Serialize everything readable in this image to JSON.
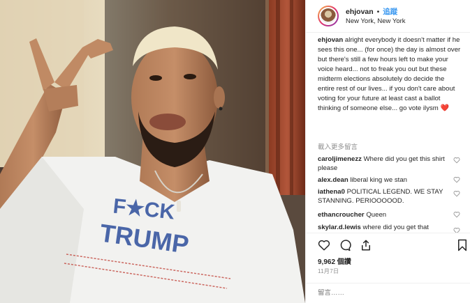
{
  "post": {
    "username": "ehjovan",
    "separator": "•",
    "follow_label": "追蹤",
    "location": "New York, New York",
    "caption_user": "ehjovan",
    "caption_text": " alright everybody it doesn't matter if he sees this one... (for once) the day is almost over but there's still a few hours left to make your voice heard... not to freak you out but these midterm elections absolutely do decide the entire rest of our lives... if you don't care about voting for your future at least cast a ballot thinking of someone else... go vote ilysm",
    "caption_emoji": "❤️",
    "load_more": "載入更多留言",
    "comments": [
      {
        "user": "caroljimenezz",
        "text": " Where did you get this shirt please"
      },
      {
        "user": "alex.dean",
        "text": " liberal king we stan"
      },
      {
        "user": "iathena0",
        "text": " POLITICAL LEGEND. WE STAY STANNING. PERIOOOOOD."
      },
      {
        "user": "ethancroucher",
        "text": " Queen"
      },
      {
        "user": "skylar.d.lewis",
        "text": " where did you get that"
      }
    ],
    "likes": "9,962 個讚",
    "date": "11月7日",
    "comment_placeholder": "留言……"
  },
  "photo": {
    "shirt_line1": "F★CK",
    "shirt_line2": "TRUMP"
  },
  "icons": {
    "like": "heart-icon",
    "comment": "comment-icon",
    "share": "share-icon",
    "save": "bookmark-icon"
  }
}
